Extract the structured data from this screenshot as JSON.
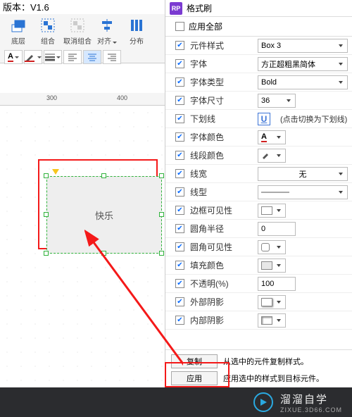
{
  "version_label": "版本：V1.6",
  "toolbar": {
    "layer": "底层",
    "group": "组合",
    "ungroup": "取消组合",
    "align": "对齐",
    "distribute": "分布"
  },
  "ruler": {
    "t300": "300",
    "t400": "400"
  },
  "widget_text": "快乐",
  "panel": {
    "title": "格式刷",
    "apply_all": "应用全部",
    "props": {
      "style": {
        "label": "元件样式",
        "value": "Box 3"
      },
      "font": {
        "label": "字体",
        "value": "方正超粗黑简体"
      },
      "font_type": {
        "label": "字体类型",
        "value": "Bold"
      },
      "font_size": {
        "label": "字体尺寸",
        "value": "36"
      },
      "underline": {
        "label": "下划线",
        "letter": "U",
        "hint": "(点击切换为下划线)"
      },
      "font_color": {
        "label": "字体颜色"
      },
      "seg_color": {
        "label": "线段颜色"
      },
      "line_width": {
        "label": "线宽",
        "value": "无"
      },
      "line_type": {
        "label": "线型"
      },
      "border_vis": {
        "label": "边框可见性"
      },
      "corner_radius": {
        "label": "圆角半径",
        "value": "0"
      },
      "corner_vis": {
        "label": "圆角可见性"
      },
      "fill_color": {
        "label": "填充颜色"
      },
      "opacity": {
        "label": "不透明(%)",
        "value": "100"
      },
      "outer_shadow": {
        "label": "外部阴影"
      },
      "inner_shadow": {
        "label": "内部阴影"
      }
    },
    "footer": {
      "copy": "复制",
      "copy_hint": "从选中的元件复制样式。",
      "apply": "应用",
      "apply_hint": "应用选中的样式到目标元件。"
    }
  },
  "banner": {
    "title": "溜溜自学",
    "sub": "ZIXUE.3D66.COM"
  }
}
